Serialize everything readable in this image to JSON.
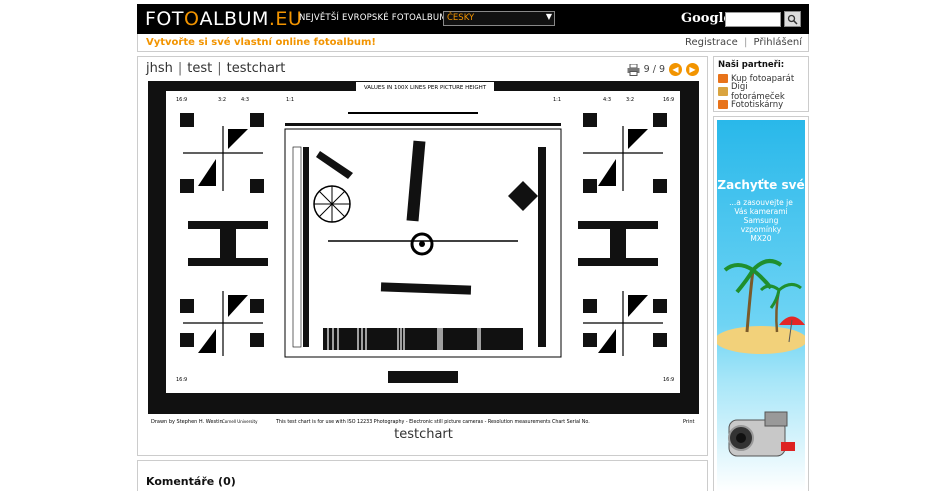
{
  "header": {
    "logo_white_1": "FOT",
    "logo_orange_1": "O",
    "logo_white_2": "ALBUM",
    "logo_orange_2": ".EU",
    "tagline": "NEJVĚTŠÍ EVROPSKÉ FOTOALBUM",
    "language": "ČESKY",
    "google_label": "Google:",
    "search_icon": "magnifier-icon"
  },
  "subbar": {
    "promo": "Vytvořte si své vlastní online fotoalbum!",
    "register": "Registrace",
    "separator": "|",
    "login": "Přihlášení"
  },
  "breadcrumb": {
    "items": [
      "jhsh",
      "test",
      "testchart"
    ],
    "separator": "|"
  },
  "pager": {
    "position": "9 / 9",
    "prev_icon": "arrow-left-icon",
    "next_icon": "arrow-right-icon",
    "print_icon": "printer-icon"
  },
  "photo": {
    "caption": "testchart",
    "chart_top_label": "VALUES IN 100X LINES PER PICTURE HEIGHT",
    "chart_footer_left": "Drawn by Stephen H. Westin",
    "chart_footer_left2": "Cornell University",
    "chart_footer_mid": "This test chart is for use with ISO 12233 Photography - Electronic still picture cameras - Resolution measurements Chart Serial No.",
    "chart_footer_right": "Print",
    "ratio_16_9": "16:9",
    "ratio_3_2": "3:2",
    "ratio_4_3": "4:3",
    "ratio_1_1": "1:1"
  },
  "comments": {
    "title": "Komentáře (0)"
  },
  "partners": {
    "title": "Naši partneři:",
    "items": [
      {
        "label": "Kup fotoaparát",
        "color": "#e8731a"
      },
      {
        "label": "Digi fotorámeček",
        "color": "#d9a440"
      },
      {
        "label": "Fototiskárny",
        "color": "#e8731a"
      }
    ]
  },
  "ad": {
    "headline": "Zachyťte své",
    "line1": "...a zasouvejte je",
    "line2": "Vás kamerami",
    "line3": "Samsung",
    "line4": "vzpomínky",
    "line5": "MX20"
  },
  "colors": {
    "brand_orange": "#f29400",
    "header_bg": "#000000",
    "border": "#cccccc"
  }
}
